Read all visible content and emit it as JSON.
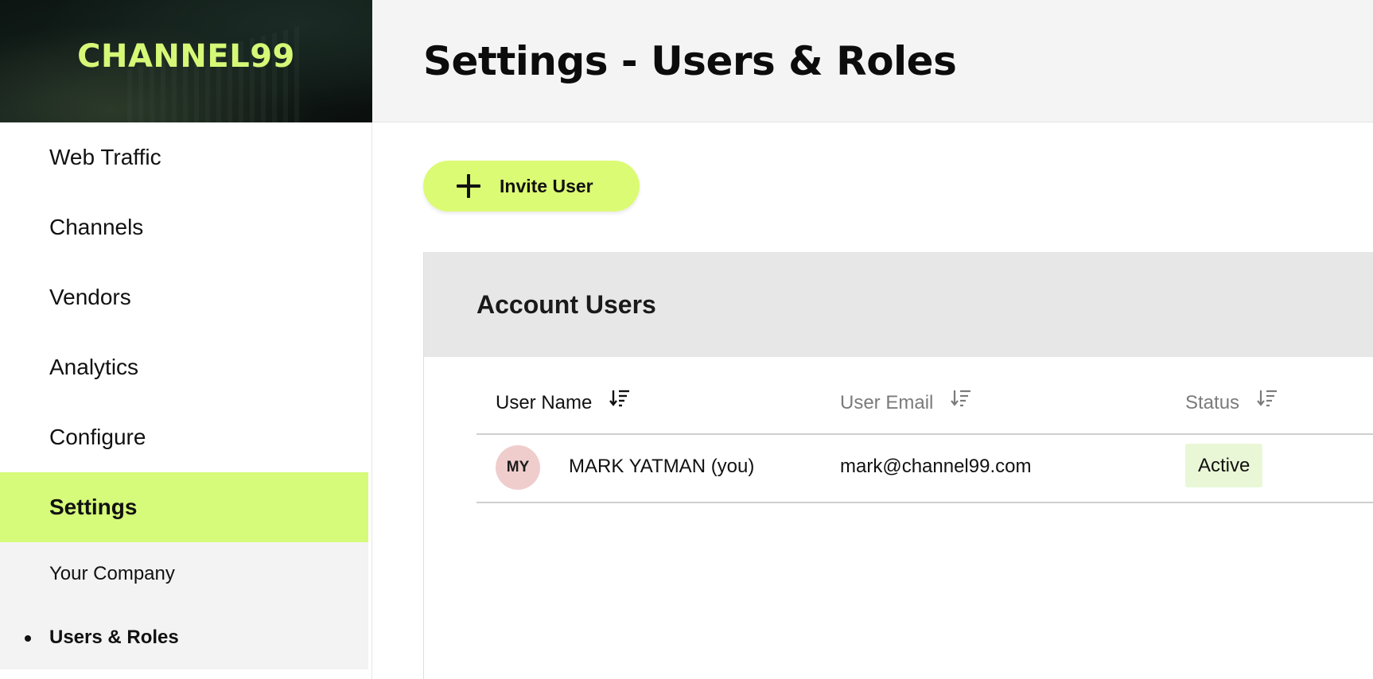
{
  "brand": {
    "logo_text": "CHANNEL99",
    "accent_color": "#d6f877"
  },
  "sidebar": {
    "items": [
      {
        "label": "Web Traffic"
      },
      {
        "label": "Channels"
      },
      {
        "label": "Vendors"
      },
      {
        "label": "Analytics"
      },
      {
        "label": "Configure"
      },
      {
        "label": "Settings",
        "active": true
      }
    ],
    "subitems": [
      {
        "label": "Your Company"
      },
      {
        "label": "Users & Roles",
        "current": true
      }
    ],
    "active_color": "#d6fb7a"
  },
  "header": {
    "title": "Settings - Users & Roles"
  },
  "actions": {
    "invite_label": "Invite User",
    "invite_icon": "plus-icon"
  },
  "users_card": {
    "title": "Account Users",
    "columns": [
      {
        "label": "User Name",
        "icon": "sort-descending-icon"
      },
      {
        "label": "User Email",
        "icon": "sort-descending-icon"
      },
      {
        "label": "Status",
        "icon": "sort-descending-icon"
      }
    ],
    "rows": [
      {
        "initials": "MY",
        "name": "MARK YATMAN (you)",
        "email": "mark@channel99.com",
        "status": "Active",
        "status_color": "#e9f7d6",
        "avatar_color": "#f0cdcd"
      }
    ]
  }
}
